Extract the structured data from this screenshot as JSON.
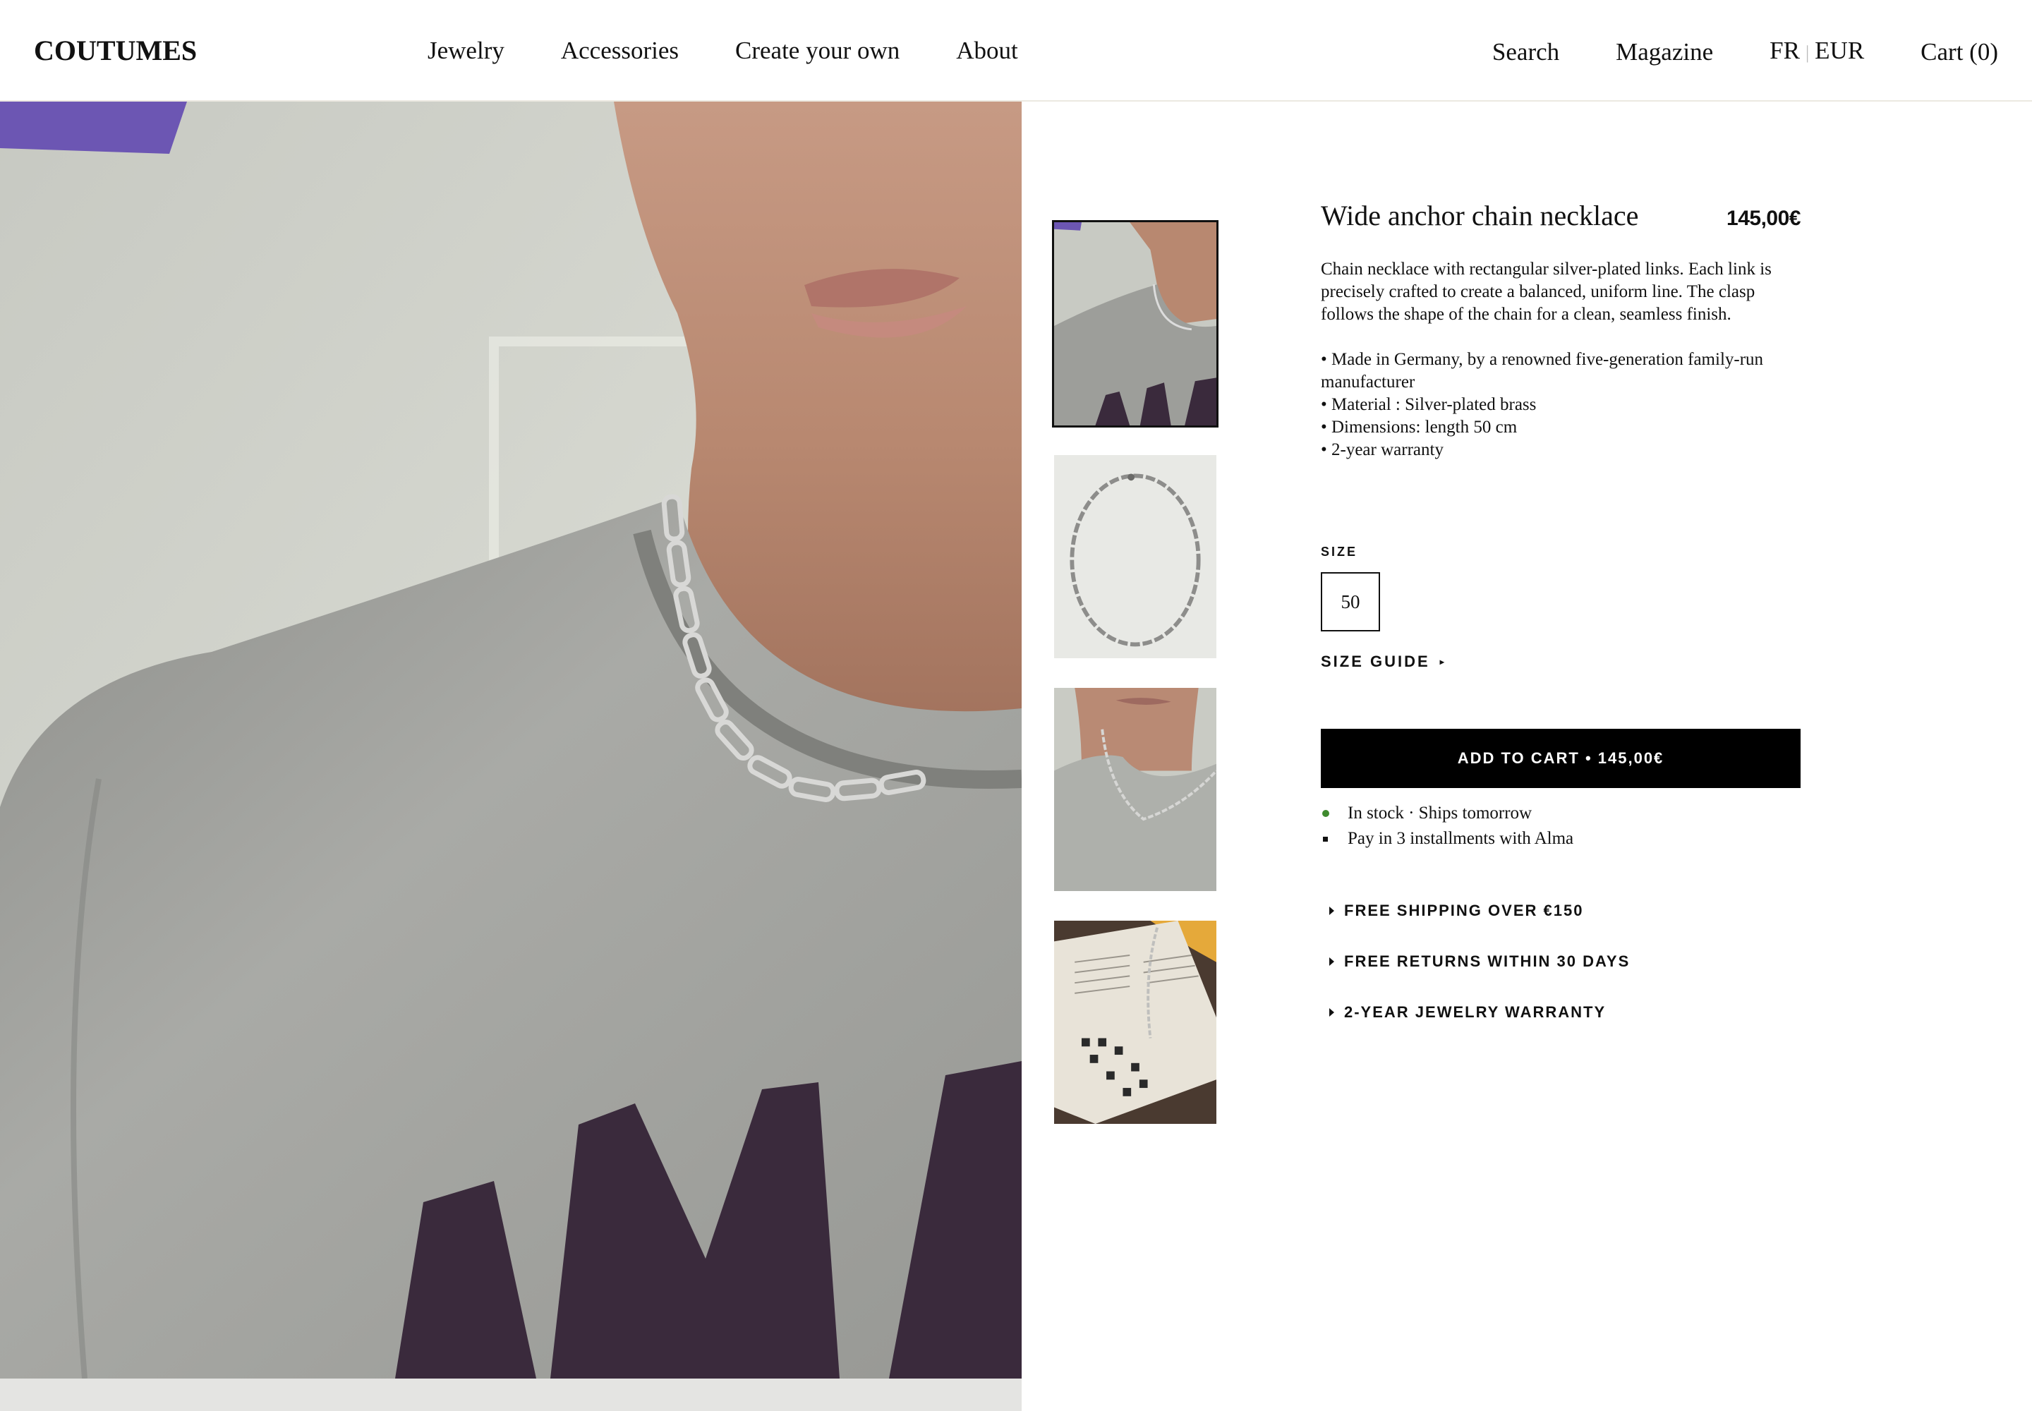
{
  "header": {
    "logo": "COUTUMES",
    "nav": [
      "Jewelry",
      "Accessories",
      "Create your own",
      "About"
    ],
    "search": "Search",
    "magazine": "Magazine",
    "locale_lang": "FR",
    "locale_currency": "EUR",
    "cart": "Cart (0)"
  },
  "gallery": {
    "thumbnail_count": 4,
    "active_index": 0
  },
  "product": {
    "title": "Wide anchor chain necklace",
    "price": "145,00€",
    "description": "Chain necklace with rectangular silver-plated links. Each link is precisely crafted to create a balanced, uniform line. The clasp follows the shape of the chain for a clean, seamless finish.",
    "bullets": [
      "• Made in Germany, by a renowned five-generation family-run manufacturer",
      "• Material : Silver-plated brass",
      "• Dimensions: length 50 cm",
      "• 2-year warranty"
    ],
    "size_label": "SIZE",
    "size_value": "50",
    "size_guide": "SIZE GUIDE",
    "add_to_cart": "ADD TO CART • 145,00€",
    "stock_status": "In stock · Ships tomorrow",
    "payment_note": "Pay in 3 installments with Alma",
    "perks": [
      "FREE SHIPPING OVER €150",
      "FREE RETURNS WITHIN 30 DAYS",
      "2-YEAR JEWELRY WARRANTY"
    ]
  },
  "colors": {
    "stock_dot": "#3f8a2e",
    "button_bg": "#000000",
    "header_border": "#ece9e1"
  }
}
